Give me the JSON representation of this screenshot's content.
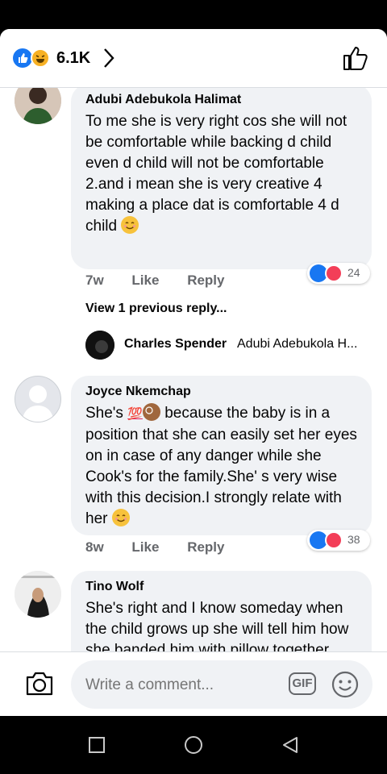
{
  "header": {
    "reaction_count": "6.1K",
    "reaction_icons": [
      "like-icon",
      "haha-icon"
    ],
    "like_button_icon": "thumbs-up-outline-icon"
  },
  "comments": [
    {
      "author": "Adubi Adebukola Halimat",
      "text": "To me she is very right cos she will not be comfortable while backing d child even d child will not be comfortable 2.and i mean she is very creative 4 making a place dat is comfortable 4 d child",
      "emoji": "smiling-face",
      "time": "7w",
      "like_label": "Like",
      "reply_label": "Reply",
      "reaction_count": "24"
    },
    {
      "author": "Joyce Nkemchap",
      "text_before": "She's",
      "inline_emoji": [
        "hundred-points",
        "ok-hand"
      ],
      "text": "because the baby is in a position that she can easily set her eyes on in case of any danger while she Cook's for the family.She' s very wise with this decision.I strongly relate with her",
      "emoji": "smiling-face",
      "time": "8w",
      "like_label": "Like",
      "reply_label": "Reply",
      "reaction_count": "38"
    },
    {
      "author": "Tino Wolf",
      "text": "She's right and I know someday when the child grows up she will tell him how she banded him with pillow together because she wanted to"
    }
  ],
  "replies": {
    "view_previous": "View 1 previous reply...",
    "preview_name": "Charles Spender",
    "preview_text": "Adubi Adebukola H..."
  },
  "composer": {
    "placeholder": "Write a comment...",
    "gif_label": "GIF"
  },
  "colors": {
    "like_blue": "#1877f2",
    "love_red": "#f33e58",
    "bubble_gray": "#f0f2f5",
    "meta_gray": "#65676b"
  }
}
